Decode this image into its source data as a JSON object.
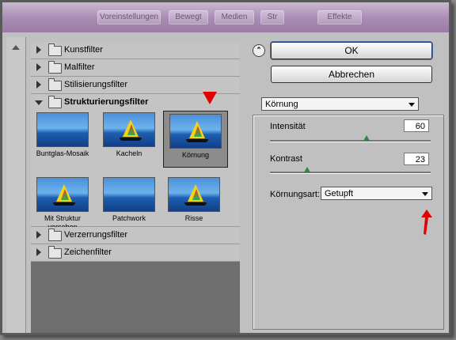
{
  "titlebar": {
    "items": [
      "Voreinstellungen",
      "Bewegt",
      "Medien",
      "Str",
      "Effekte"
    ]
  },
  "tree": {
    "categories_top": [
      {
        "label": "Kunstfilter"
      },
      {
        "label": "Malfilter"
      },
      {
        "label": "Stilisierungsfilter"
      }
    ],
    "open_category": {
      "label": "Strukturierungsfilter"
    },
    "thumbnails": [
      {
        "label": "Buntglas-Mosaik"
      },
      {
        "label": "Kacheln"
      },
      {
        "label": "Körnung"
      },
      {
        "label": "Mit Struktur versehen"
      },
      {
        "label": "Patchwork"
      },
      {
        "label": "Risse"
      }
    ],
    "selected_thumbnail": "Körnung",
    "categories_bottom": [
      {
        "label": "Verzerrungsfilter"
      },
      {
        "label": "Zeichenfilter"
      }
    ]
  },
  "buttons": {
    "ok": "OK",
    "cancel": "Abbrechen"
  },
  "filter_select": {
    "value": "Körnung"
  },
  "intensity": {
    "label": "Intensität",
    "value": "60",
    "level_fraction": 0.6
  },
  "contrast": {
    "label": "Kontrast",
    "value": "23",
    "level_fraction": 0.23
  },
  "grain_type": {
    "label": "Körnungsart:",
    "value": "Getupft"
  },
  "colors": {
    "annotation_red": "#e00000",
    "slider_thumb": "#2c8a3a",
    "titlebar": "#a88ab3"
  }
}
